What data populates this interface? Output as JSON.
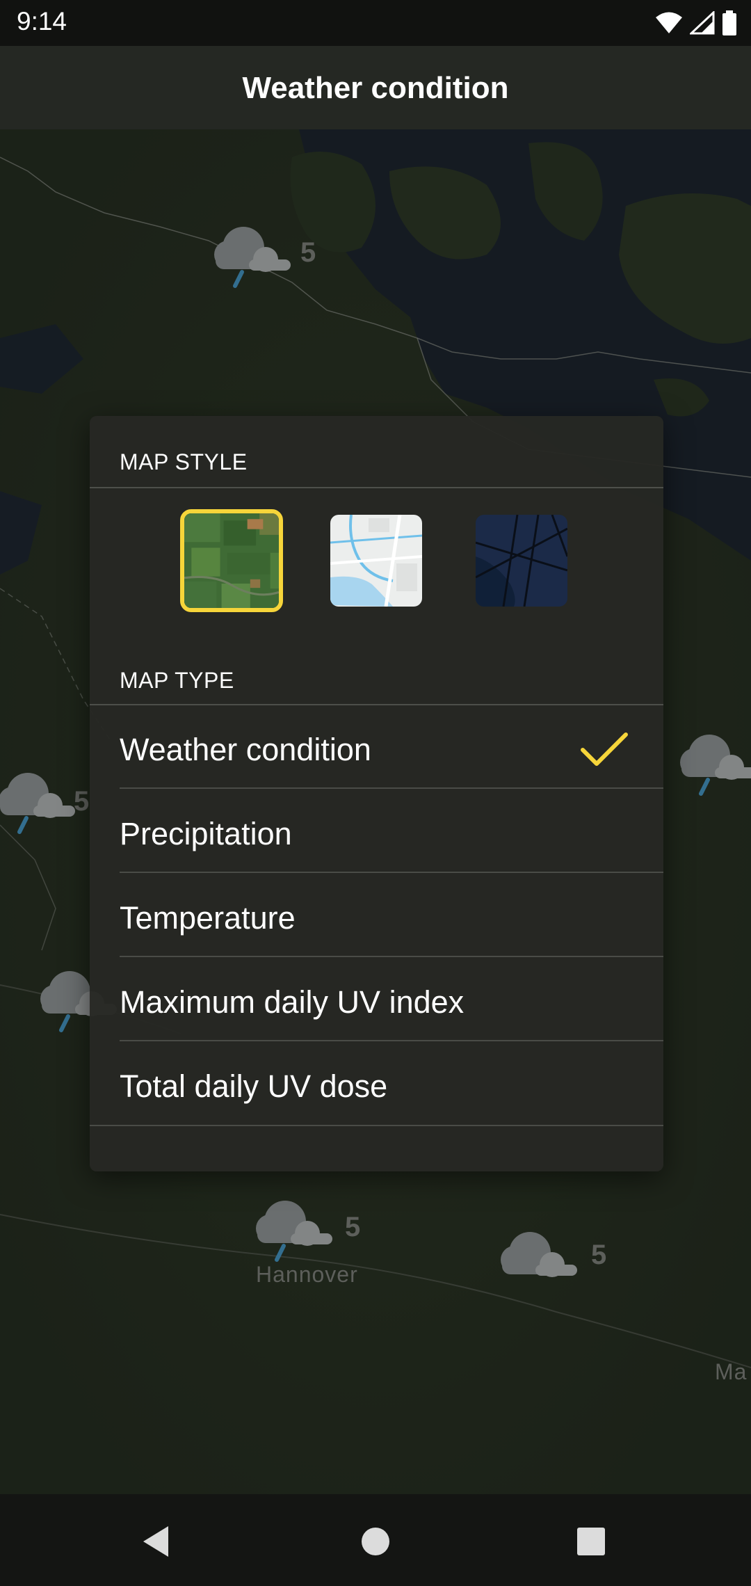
{
  "status_bar": {
    "time": "9:14",
    "icons": [
      "wifi-icon",
      "signal-icon",
      "battery-icon"
    ]
  },
  "app_bar": {
    "title": "Weather condition"
  },
  "map": {
    "markers": [
      {
        "value": "5",
        "icon": "rain-cloud-icon"
      },
      {
        "value": "5",
        "icon": "rain-cloud-icon"
      },
      {
        "value": "5",
        "icon": "rain-cloud-icon"
      },
      {
        "value": "5",
        "icon": "rain-cloud-icon"
      },
      {
        "value": "5",
        "icon": "cloud-icon"
      }
    ],
    "labels": {
      "hannover": "Hannover",
      "ma_partial": "Ma"
    }
  },
  "dialog": {
    "map_style_header": "MAP STYLE",
    "map_styles": [
      {
        "name": "satellite",
        "selected": true
      },
      {
        "name": "light",
        "selected": false
      },
      {
        "name": "dark",
        "selected": false
      }
    ],
    "map_type_header": "MAP TYPE",
    "map_types": [
      {
        "label": "Weather condition",
        "selected": true
      },
      {
        "label": "Precipitation",
        "selected": false
      },
      {
        "label": "Temperature",
        "selected": false
      },
      {
        "label": "Maximum daily UV index",
        "selected": false
      },
      {
        "label": "Total daily UV dose",
        "selected": false
      }
    ]
  },
  "colors": {
    "accent": "#f6d53a",
    "dialog_bg": "#262823",
    "rain": "#4aa3d8"
  }
}
